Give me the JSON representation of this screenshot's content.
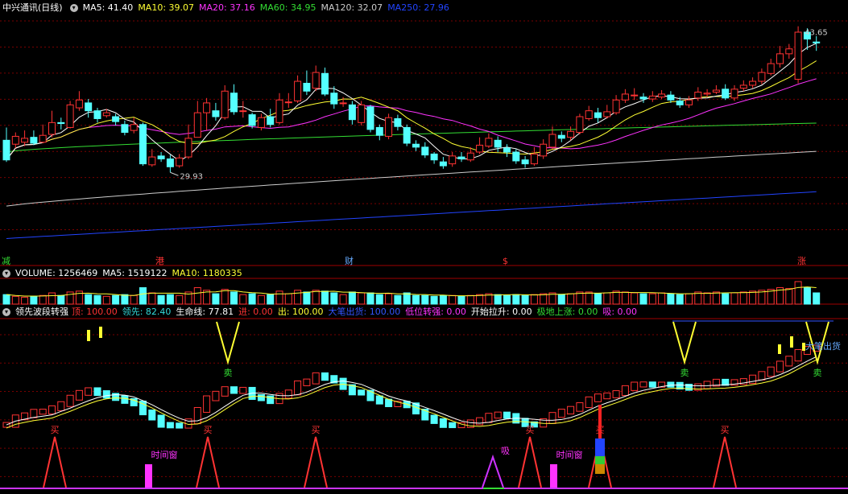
{
  "header": {
    "stock_name": "中兴通讯(日线)",
    "ma": [
      {
        "label": "MA5: 41.40",
        "color": "#ffffff"
      },
      {
        "label": "MA10: 39.07",
        "color": "#ffff33"
      },
      {
        "label": "MA20: 37.16",
        "color": "#ff33ff"
      },
      {
        "label": "MA60: 34.95",
        "color": "#33dd33"
      },
      {
        "label": "MA120: 32.07",
        "color": "#cccccc"
      },
      {
        "label": "MA250: 27.96",
        "color": "#2244ff"
      }
    ]
  },
  "price_panel": {
    "high_label": "43.65",
    "low_label": "29.93",
    "markers": [
      {
        "text": "减",
        "color": "#33dd33",
        "x": 2
      },
      {
        "text": "港",
        "color": "#ff3333",
        "x": 193
      },
      {
        "text": "财",
        "color": "#66aaff",
        "x": 428
      },
      {
        "text": "$",
        "color": "#ff3333",
        "x": 624
      },
      {
        "text": "涨",
        "color": "#ff3333",
        "x": 990
      }
    ]
  },
  "volume_panel": {
    "label": "VOLUME: 1256469",
    "ma5": "MA5: 1519122",
    "ma10": "MA10: 1180335"
  },
  "indicator_panel": {
    "name": "领先波段转强",
    "fields": [
      {
        "label": "顶: 100.00",
        "color": "#ff3333"
      },
      {
        "label": "领先: 82.40",
        "color": "#33dddd"
      },
      {
        "label": "生命线: 77.81",
        "color": "#ffffff"
      },
      {
        "label": "进: 0.00",
        "color": "#ff3333"
      },
      {
        "label": "出: 100.00",
        "color": "#ffff33"
      },
      {
        "label": "大笔出货: 100.00",
        "color": "#3355ff"
      },
      {
        "label": "低位转强: 0.00",
        "color": "#ff33ff"
      },
      {
        "label": "开始拉升: 0.00",
        "color": "#ffffff"
      },
      {
        "label": "极地上涨: 0.00",
        "color": "#33dd33"
      },
      {
        "label": "吸: 0.00",
        "color": "#ff33ff"
      }
    ],
    "buy_label": "买",
    "sell_label": "卖",
    "time_window_label": "时间窗",
    "absorb_label": "吸",
    "big_sell_label": "大笔出货"
  },
  "colors": {
    "up": "#ff3333",
    "down": "#54ffff",
    "grid": "#7a0000",
    "bg": "#000000",
    "ma5": "#ffffff",
    "ma10": "#ffff33",
    "ma20": "#ff33ff",
    "ma60": "#33dd33",
    "ma120": "#cccccc",
    "ma250": "#2244ff"
  },
  "chart_data": {
    "type": "candlestick",
    "candles": [
      [
        33.2,
        31.2,
        34.5,
        31.0
      ],
      [
        32.8,
        33.6,
        34.0,
        32.4
      ],
      [
        33.0,
        33.4,
        34.2,
        32.6
      ],
      [
        33.5,
        32.9,
        34.2,
        32.7
      ],
      [
        33.0,
        33.7,
        34.8,
        32.9
      ],
      [
        33.8,
        35.0,
        36.2,
        33.5
      ],
      [
        35.0,
        34.9,
        35.5,
        34.3
      ],
      [
        34.5,
        36.8,
        37.2,
        34.4
      ],
      [
        36.5,
        37.3,
        38.2,
        36.2
      ],
      [
        37.0,
        36.2,
        37.4,
        35.5
      ],
      [
        36.2,
        35.4,
        36.5,
        35.0
      ],
      [
        35.7,
        36.0,
        36.4,
        35.5
      ],
      [
        35.6,
        35.1,
        35.9,
        34.7
      ],
      [
        34.8,
        34.0,
        35.2,
        33.7
      ],
      [
        34.2,
        34.8,
        35.5,
        33.9
      ],
      [
        34.8,
        30.8,
        35.0,
        30.6
      ],
      [
        30.7,
        31.5,
        32.3,
        30.5
      ],
      [
        31.6,
        31.3,
        32.0,
        31.0
      ],
      [
        31.3,
        30.5,
        31.7,
        29.93
      ],
      [
        30.6,
        31.4,
        31.8,
        30.4
      ],
      [
        31.5,
        33.4,
        34.8,
        31.3
      ],
      [
        33.5,
        36.0,
        37.2,
        33.5
      ],
      [
        36.0,
        37.0,
        37.5,
        34.2
      ],
      [
        36.2,
        35.6,
        37.0,
        35.2
      ],
      [
        35.5,
        38.2,
        38.8,
        35.3
      ],
      [
        38.0,
        36.1,
        38.9,
        35.8
      ],
      [
        36.2,
        36.2,
        37.2,
        35.5
      ],
      [
        35.8,
        34.7,
        36.0,
        34.4
      ],
      [
        34.5,
        35.5,
        35.9,
        34.2
      ],
      [
        35.6,
        34.8,
        36.4,
        34.5
      ],
      [
        35.0,
        37.3,
        38.0,
        34.8
      ],
      [
        37.1,
        37.1,
        38.0,
        36.5
      ],
      [
        37.2,
        39.2,
        39.8,
        37.0
      ],
      [
        39.0,
        38.2,
        40.3,
        37.8
      ],
      [
        38.5,
        40.1,
        40.8,
        38.2
      ],
      [
        40.0,
        37.9,
        40.6,
        37.7
      ],
      [
        38.0,
        36.9,
        38.7,
        36.4
      ],
      [
        37.0,
        37.0,
        37.6,
        36.6
      ],
      [
        36.8,
        35.3,
        37.2,
        34.8
      ],
      [
        35.0,
        36.8,
        37.2,
        34.7
      ],
      [
        36.6,
        34.3,
        36.8,
        34.0
      ],
      [
        34.5,
        33.7,
        34.8,
        33.2
      ],
      [
        33.6,
        35.5,
        35.9,
        33.3
      ],
      [
        35.4,
        34.6,
        35.8,
        34.2
      ],
      [
        34.5,
        32.9,
        34.8,
        32.6
      ],
      [
        32.8,
        32.5,
        33.2,
        32.1
      ],
      [
        32.5,
        31.7,
        33.0,
        31.4
      ],
      [
        31.8,
        31.2,
        32.0,
        30.8
      ],
      [
        31.0,
        30.6,
        31.5,
        30.3
      ],
      [
        30.8,
        31.6,
        32.0,
        30.5
      ],
      [
        31.5,
        31.3,
        32.0,
        31.0
      ],
      [
        31.2,
        31.9,
        32.5,
        31.0
      ],
      [
        32.0,
        32.7,
        33.5,
        31.8
      ],
      [
        32.6,
        33.4,
        33.9,
        32.4
      ],
      [
        33.2,
        32.5,
        33.6,
        32.0
      ],
      [
        32.4,
        32.0,
        32.8,
        31.5
      ],
      [
        32.0,
        31.1,
        32.3,
        30.8
      ],
      [
        31.2,
        30.8,
        31.6,
        30.4
      ],
      [
        30.8,
        31.8,
        32.5,
        30.6
      ],
      [
        31.6,
        32.8,
        33.3,
        31.3
      ],
      [
        32.5,
        33.8,
        34.6,
        32.3
      ],
      [
        33.7,
        33.4,
        34.1,
        33.0
      ],
      [
        33.5,
        34.1,
        34.6,
        33.2
      ],
      [
        34.0,
        35.6,
        35.9,
        33.8
      ],
      [
        35.4,
        36.2,
        36.7,
        35.2
      ],
      [
        36.0,
        35.5,
        36.5,
        35.0
      ],
      [
        35.6,
        36.1,
        36.8,
        35.4
      ],
      [
        36.0,
        37.3,
        37.8,
        35.8
      ],
      [
        37.3,
        37.9,
        38.4,
        37.0
      ],
      [
        37.8,
        37.8,
        38.5,
        37.3
      ],
      [
        37.6,
        37.4,
        38.0,
        37.0
      ],
      [
        37.4,
        37.7,
        38.2,
        37.1
      ],
      [
        37.6,
        37.9,
        38.3,
        37.4
      ],
      [
        37.8,
        37.3,
        38.2,
        37.0
      ],
      [
        37.2,
        36.8,
        37.6,
        36.5
      ],
      [
        36.8,
        37.3,
        37.7,
        36.5
      ],
      [
        37.5,
        38.1,
        38.6,
        37.2
      ],
      [
        37.9,
        38.0,
        38.4,
        37.6
      ],
      [
        38.1,
        38.3,
        38.8,
        37.9
      ],
      [
        38.4,
        37.5,
        38.9,
        37.3
      ],
      [
        37.5,
        38.4,
        38.8,
        37.2
      ],
      [
        38.5,
        38.8,
        39.3,
        38.2
      ],
      [
        38.8,
        39.2,
        39.6,
        38.5
      ],
      [
        39.2,
        40.1,
        40.5,
        38.9
      ],
      [
        40.0,
        41.0,
        41.5,
        39.8
      ],
      [
        41.0,
        42.0,
        42.8,
        40.6
      ],
      [
        42.0,
        42.5,
        43.0,
        41.5
      ],
      [
        39.4,
        44.2,
        44.8,
        39.0
      ],
      [
        44.2,
        43.5,
        44.6,
        42.4
      ],
      [
        43.2,
        43.1,
        43.8,
        42.3
      ]
    ],
    "volumes": [
      1.1,
      0.9,
      0.8,
      0.9,
      1.0,
      1.3,
      1.0,
      1.4,
      1.5,
      1.1,
      1.0,
      0.9,
      1.0,
      1.1,
      1.0,
      1.9,
      1.3,
      1.0,
      1.1,
      1.0,
      1.4,
      1.9,
      1.6,
      1.2,
      1.7,
      1.4,
      1.1,
      1.2,
      1.0,
      1.1,
      1.5,
      1.2,
      1.6,
      1.4,
      1.6,
      1.5,
      1.3,
      1.1,
      1.4,
      1.3,
      1.3,
      1.1,
      1.2,
      1.0,
      1.3,
      1.0,
      1.0,
      0.9,
      1.0,
      1.0,
      0.9,
      1.0,
      1.1,
      1.2,
      1.1,
      1.0,
      1.1,
      1.0,
      1.1,
      1.2,
      1.3,
      1.1,
      1.2,
      1.4,
      1.4,
      1.2,
      1.3,
      1.5,
      1.4,
      1.3,
      1.2,
      1.2,
      1.3,
      1.2,
      1.1,
      1.2,
      1.4,
      1.3,
      1.4,
      1.2,
      1.3,
      1.4,
      1.5,
      1.6,
      1.7,
      1.9,
      1.8,
      2.6,
      1.9,
      1.3
    ],
    "ma60": [
      32.0,
      34.95
    ],
    "ma120": [
      26.5,
      32.07
    ],
    "ma250": [
      23.2,
      27.96
    ],
    "y_range": [
      22.5,
      46.0
    ]
  }
}
